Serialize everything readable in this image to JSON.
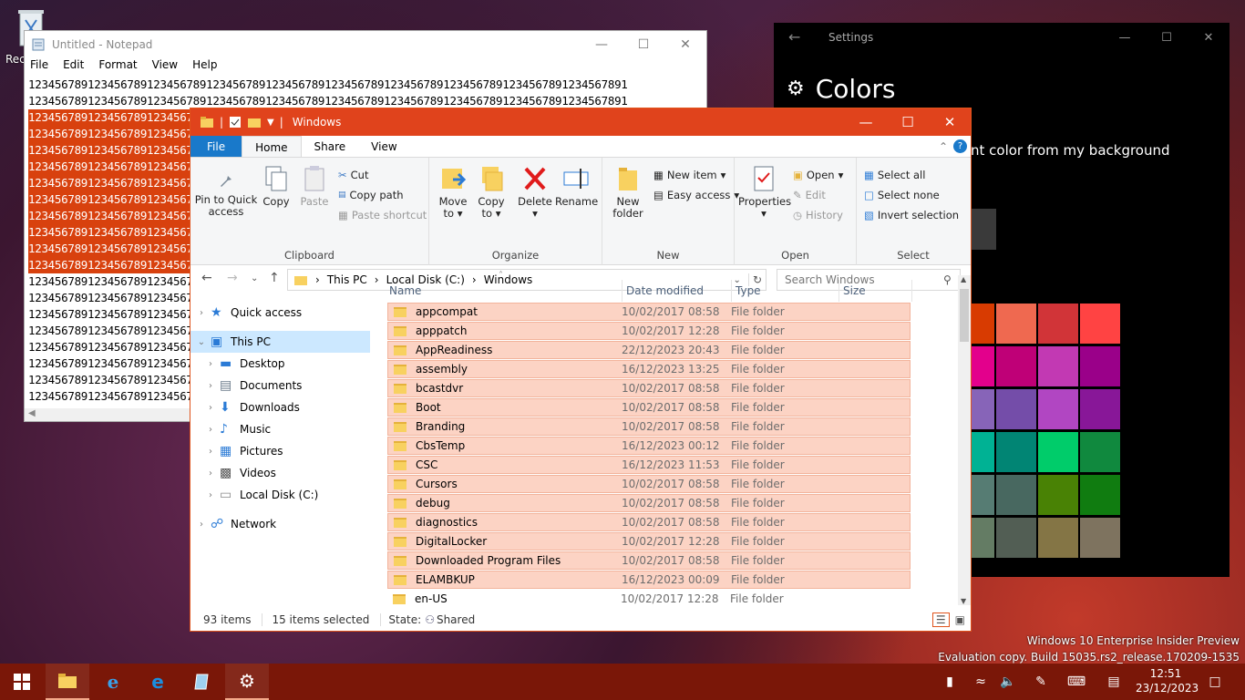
{
  "desktop": {
    "recycle_label": "Rec"
  },
  "notepad": {
    "title": "Untitled - Notepad",
    "menu": [
      "File",
      "Edit",
      "Format",
      "View",
      "Help"
    ],
    "full_line": "1234567891234567891234567891234567891234567891234567891234567891234567891234567891234567891",
    "lines_full": 2,
    "lines_visible": 20,
    "selected_lines": [
      2,
      3,
      4,
      5,
      6,
      7,
      8,
      9,
      10,
      11
    ]
  },
  "settings": {
    "title": "Settings",
    "heading": "Colors",
    "auto_accent_text": "nt color from my background",
    "swatches": [
      [
        "#d83b01",
        "#ef6950",
        "#d13438",
        "#ff4343"
      ],
      [
        "#e3008c",
        "#bf0077",
        "#c239b3",
        "#9a0089"
      ],
      [
        "#8764b8",
        "#744da9",
        "#b146c2",
        "#881798"
      ],
      [
        "#00b294",
        "#018574",
        "#00cc6a",
        "#10893e"
      ],
      [
        "#567c73",
        "#486860",
        "#498205",
        "#107c10"
      ],
      [
        "#647c64",
        "#525e54",
        "#847545",
        "#7e735f"
      ]
    ]
  },
  "explorer": {
    "title": "Windows",
    "tabs": {
      "file": "File",
      "home": "Home",
      "share": "Share",
      "view": "View"
    },
    "ribbon": {
      "pin": "Pin to Quick access",
      "copy": "Copy",
      "paste": "Paste",
      "cut": "Cut",
      "copy_path": "Copy path",
      "paste_shortcut": "Paste shortcut",
      "clipboard": "Clipboard",
      "move_to": "Move to",
      "copy_to": "Copy to",
      "delete": "Delete",
      "rename": "Rename",
      "organize": "Organize",
      "new_folder": "New folder",
      "new_item": "New item",
      "easy_access": "Easy access",
      "new": "New",
      "properties": "Properties",
      "open": "Open",
      "edit": "Edit",
      "history": "History",
      "open_group": "Open",
      "select_all": "Select all",
      "select_none": "Select none",
      "invert_selection": "Invert selection",
      "select": "Select"
    },
    "address": [
      "This PC",
      "Local Disk (C:)",
      "Windows"
    ],
    "search_placeholder": "Search Windows",
    "nav": [
      {
        "label": "Quick access",
        "indent": 0
      },
      {
        "label": "This PC",
        "indent": 0
      },
      {
        "label": "Desktop",
        "indent": 1
      },
      {
        "label": "Documents",
        "indent": 1
      },
      {
        "label": "Downloads",
        "indent": 1
      },
      {
        "label": "Music",
        "indent": 1
      },
      {
        "label": "Pictures",
        "indent": 1
      },
      {
        "label": "Videos",
        "indent": 1
      },
      {
        "label": "Local Disk (C:)",
        "indent": 1
      },
      {
        "label": "Network",
        "indent": 0
      }
    ],
    "columns": [
      "Name",
      "Date modified",
      "Type",
      "Size"
    ],
    "files": [
      {
        "name": "appcompat",
        "date": "10/02/2017 08:58",
        "type": "File folder",
        "selected": true
      },
      {
        "name": "apppatch",
        "date": "10/02/2017 12:28",
        "type": "File folder",
        "selected": true
      },
      {
        "name": "AppReadiness",
        "date": "22/12/2023 20:43",
        "type": "File folder",
        "selected": true
      },
      {
        "name": "assembly",
        "date": "16/12/2023 13:25",
        "type": "File folder",
        "selected": true
      },
      {
        "name": "bcastdvr",
        "date": "10/02/2017 08:58",
        "type": "File folder",
        "selected": true
      },
      {
        "name": "Boot",
        "date": "10/02/2017 08:58",
        "type": "File folder",
        "selected": true
      },
      {
        "name": "Branding",
        "date": "10/02/2017 08:58",
        "type": "File folder",
        "selected": true
      },
      {
        "name": "CbsTemp",
        "date": "16/12/2023 00:12",
        "type": "File folder",
        "selected": true
      },
      {
        "name": "CSC",
        "date": "16/12/2023 11:53",
        "type": "File folder",
        "selected": true
      },
      {
        "name": "Cursors",
        "date": "10/02/2017 08:58",
        "type": "File folder",
        "selected": true
      },
      {
        "name": "debug",
        "date": "10/02/2017 08:58",
        "type": "File folder",
        "selected": true
      },
      {
        "name": "diagnostics",
        "date": "10/02/2017 08:58",
        "type": "File folder",
        "selected": true
      },
      {
        "name": "DigitalLocker",
        "date": "10/02/2017 12:28",
        "type": "File folder",
        "selected": true
      },
      {
        "name": "Downloaded Program Files",
        "date": "10/02/2017 08:58",
        "type": "File folder",
        "selected": true
      },
      {
        "name": "ELAMBKUP",
        "date": "16/12/2023 00:09",
        "type": "File folder",
        "selected": true
      },
      {
        "name": "en-US",
        "date": "10/02/2017 12:28",
        "type": "File folder",
        "selected": false
      }
    ],
    "status": {
      "items": "93 items",
      "selected": "15 items selected",
      "state_label": "State:",
      "state_value": "Shared"
    }
  },
  "taskbar": {
    "time": "12:51",
    "date": "23/12/2023"
  },
  "watermark": {
    "line1": "Windows 10 Enterprise Insider Preview",
    "line2": "Evaluation copy. Build 15035.rs2_release.170209-1535"
  }
}
